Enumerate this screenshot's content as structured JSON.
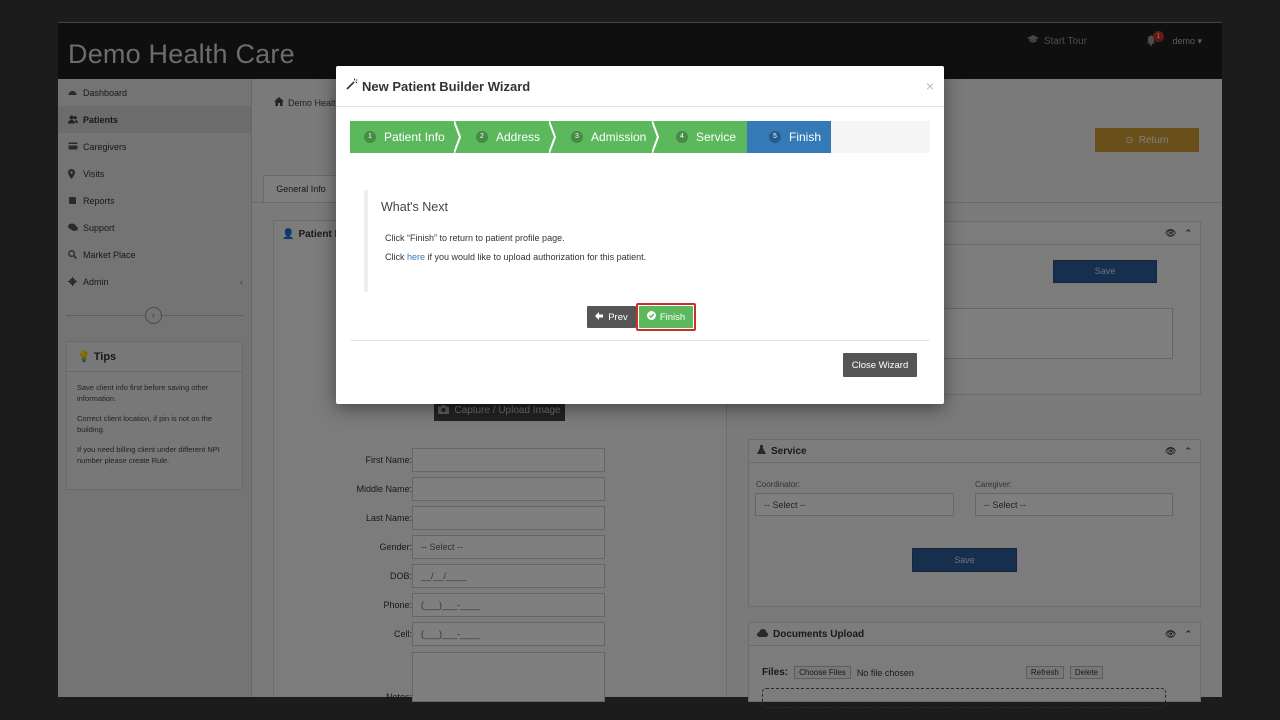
{
  "app": {
    "title": "Demo Health Care",
    "header": {
      "tour_label": "Start Tour",
      "notification_count": "1",
      "user_label": "demo ▾"
    },
    "breadcrumb": "Demo Healt",
    "return_label": "Return",
    "tab_general": "General Info"
  },
  "sidebar": {
    "items": [
      {
        "label": "Dashboard",
        "icon": "dashboard-icon"
      },
      {
        "label": "Patients",
        "icon": "users-icon"
      },
      {
        "label": "Caregivers",
        "icon": "card-icon"
      },
      {
        "label": "Visits",
        "icon": "map-marker-icon"
      },
      {
        "label": "Reports",
        "icon": "book-icon"
      },
      {
        "label": "Support",
        "icon": "comments-icon"
      },
      {
        "label": "Market Place",
        "icon": "search-icon"
      },
      {
        "label": "Admin",
        "icon": "gear-icon"
      }
    ],
    "admin_chevron": "‹",
    "collapse_symbol": "‹",
    "tips": {
      "title": "Tips",
      "lines": [
        "Save client info first before saving other information.",
        "Correct client location, if pin is not on the building.",
        "If you need billing client under different NPI number please create Rule."
      ]
    }
  },
  "patient_card": {
    "title": "Patient In",
    "capture_label": "Capture / Upload Image",
    "fields": {
      "first_name": "First Name:",
      "middle_name": "Middle Name:",
      "last_name": "Last Name:",
      "gender": "Gender:",
      "gender_value": "-- Select --",
      "dob": "DOB:",
      "dob_placeholder": "__/__/____",
      "phone": "Phone:",
      "phone_placeholder": "(___)___-____",
      "cell": "Cell:",
      "cell_placeholder": "(___)___-____",
      "notes": "Notes:"
    }
  },
  "right_cards": {
    "top_save": "Save",
    "service": {
      "title": "Service",
      "coordinator_label": "Coordinator:",
      "coordinator_value": "-- Select --",
      "caregiver_label": "Caregiver:",
      "caregiver_value": "-- Select --",
      "save": "Save"
    },
    "documents": {
      "title": "Documents Upload",
      "files_label": "Files:",
      "choose_files": "Choose Files",
      "no_file": "No file chosen",
      "refresh": "Refresh",
      "delete": "Delete"
    }
  },
  "modal": {
    "title": "New Patient Builder Wizard",
    "close_symbol": "×",
    "steps": [
      {
        "num": "1",
        "label": "Patient Info",
        "state": "complete"
      },
      {
        "num": "2",
        "label": "Address",
        "state": "complete"
      },
      {
        "num": "3",
        "label": "Admission",
        "state": "complete"
      },
      {
        "num": "4",
        "label": "Service",
        "state": "complete"
      },
      {
        "num": "5",
        "label": "Finish",
        "state": "active"
      }
    ],
    "whats_next": {
      "title": "What's Next",
      "line1": "Click “Finish” to return to patient profile page.",
      "line2_prefix": "Click ",
      "line2_link": "here",
      "line2_suffix": " if you would like to upload authorization for this patient."
    },
    "prev_label": "Prev",
    "finish_label": "Finish",
    "close_wizard_label": "Close Wizard"
  },
  "colors": {
    "step_complete": "#5cb85c",
    "step_active": "#337ab7",
    "finish_highlight": "#c9302c",
    "return_button": "#d39e33",
    "save_button": "#2e5e9e"
  }
}
